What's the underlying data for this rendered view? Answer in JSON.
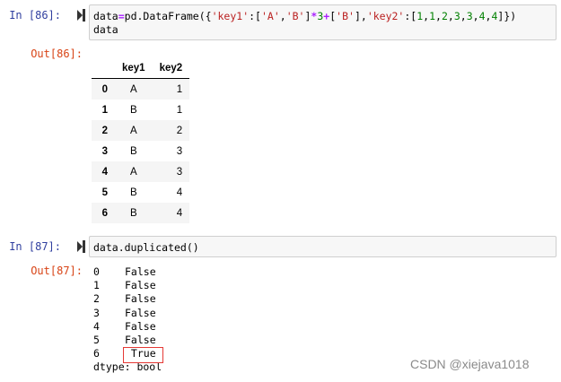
{
  "cells": [
    {
      "in_prompt": "In  [86]:",
      "code": {
        "line1": [
          {
            "t": "data",
            "c": "plain"
          },
          {
            "t": "=",
            "c": "op"
          },
          {
            "t": "pd.DataFrame({",
            "c": "plain"
          },
          {
            "t": "'key1'",
            "c": "str"
          },
          {
            "t": ":[",
            "c": "plain"
          },
          {
            "t": "'A'",
            "c": "str"
          },
          {
            "t": ",",
            "c": "plain"
          },
          {
            "t": "'B'",
            "c": "str"
          },
          {
            "t": "]",
            "c": "plain"
          },
          {
            "t": "*",
            "c": "op"
          },
          {
            "t": "3",
            "c": "num"
          },
          {
            "t": "+",
            "c": "op"
          },
          {
            "t": "[",
            "c": "plain"
          },
          {
            "t": "'B'",
            "c": "str"
          },
          {
            "t": "],",
            "c": "plain"
          },
          {
            "t": "'key2'",
            "c": "str"
          },
          {
            "t": ":[",
            "c": "plain"
          },
          {
            "t": "1",
            "c": "num"
          },
          {
            "t": ",",
            "c": "plain"
          },
          {
            "t": "1",
            "c": "num"
          },
          {
            "t": ",",
            "c": "plain"
          },
          {
            "t": "2",
            "c": "num"
          },
          {
            "t": ",",
            "c": "plain"
          },
          {
            "t": "3",
            "c": "num"
          },
          {
            "t": ",",
            "c": "plain"
          },
          {
            "t": "3",
            "c": "num"
          },
          {
            "t": ",",
            "c": "plain"
          },
          {
            "t": "4",
            "c": "num"
          },
          {
            "t": ",",
            "c": "plain"
          },
          {
            "t": "4",
            "c": "num"
          },
          {
            "t": "]})",
            "c": "plain"
          }
        ],
        "line2": "data"
      },
      "out_prompt": "Out[86]:",
      "table": {
        "columns": [
          "",
          "key1",
          "key2"
        ],
        "rows": [
          {
            "index": "0",
            "key1": "A",
            "key2": "1"
          },
          {
            "index": "1",
            "key1": "B",
            "key2": "1"
          },
          {
            "index": "2",
            "key1": "A",
            "key2": "2"
          },
          {
            "index": "3",
            "key1": "B",
            "key2": "3"
          },
          {
            "index": "4",
            "key1": "A",
            "key2": "3"
          },
          {
            "index": "5",
            "key1": "B",
            "key2": "4"
          },
          {
            "index": "6",
            "key1": "B",
            "key2": "4"
          }
        ]
      }
    },
    {
      "in_prompt": "In  [87]:",
      "code": "data.duplicated()",
      "out_prompt": "Out[87]:",
      "series": [
        {
          "index": "0",
          "value": "False"
        },
        {
          "index": "1",
          "value": "False"
        },
        {
          "index": "2",
          "value": "False"
        },
        {
          "index": "3",
          "value": "False"
        },
        {
          "index": "4",
          "value": "False"
        },
        {
          "index": "5",
          "value": "False"
        },
        {
          "index": "6",
          "value": "True"
        }
      ],
      "dtype": "dtype: bool"
    }
  ],
  "watermark": "CSDN @xiejava1018",
  "colors": {
    "in_prompt": "#303f9f",
    "out_prompt": "#d84315",
    "string": "#ba2121",
    "number": "#008000",
    "operator": "#aa22ff",
    "highlight_box": "#e53935"
  }
}
